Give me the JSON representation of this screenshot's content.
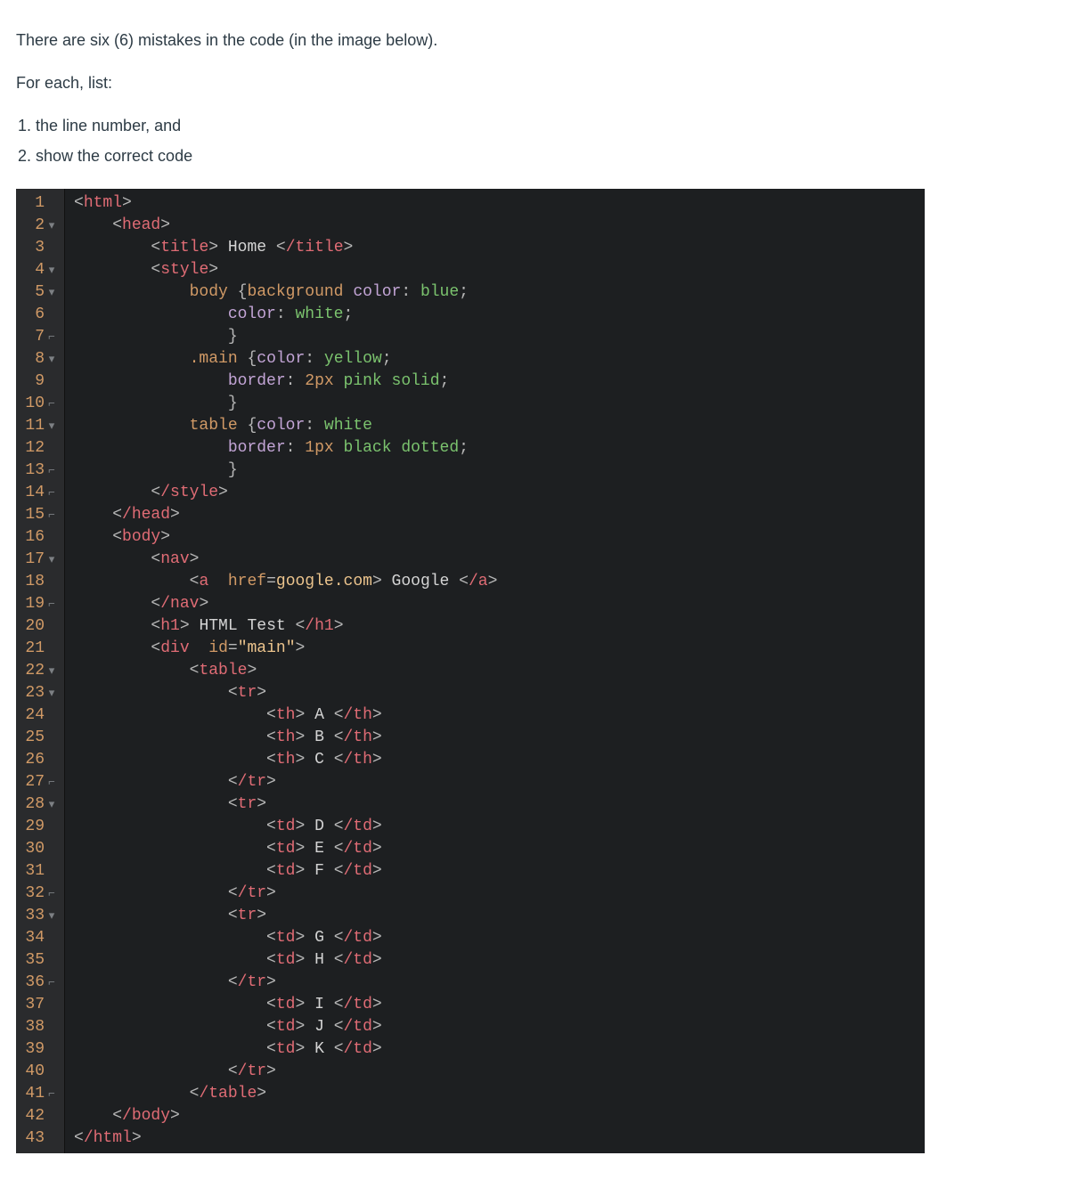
{
  "prompt": {
    "p1": "There are six (6) mistakes in the code (in the image below).",
    "p2": "For each, list:",
    "li1": "the line number, and",
    "li2": "show the correct code"
  },
  "gutter": [
    {
      "n": "1",
      "m": ""
    },
    {
      "n": "2",
      "m": "▾"
    },
    {
      "n": "3",
      "m": ""
    },
    {
      "n": "4",
      "m": "▾"
    },
    {
      "n": "5",
      "m": "▾"
    },
    {
      "n": "6",
      "m": ""
    },
    {
      "n": "7",
      "m": "⌐"
    },
    {
      "n": "8",
      "m": "▾"
    },
    {
      "n": "9",
      "m": ""
    },
    {
      "n": "10",
      "m": "⌐"
    },
    {
      "n": "11",
      "m": "▾"
    },
    {
      "n": "12",
      "m": ""
    },
    {
      "n": "13",
      "m": "⌐"
    },
    {
      "n": "14",
      "m": "⌐"
    },
    {
      "n": "15",
      "m": "⌐"
    },
    {
      "n": "16",
      "m": ""
    },
    {
      "n": "17",
      "m": "▾"
    },
    {
      "n": "18",
      "m": ""
    },
    {
      "n": "19",
      "m": "⌐"
    },
    {
      "n": "20",
      "m": ""
    },
    {
      "n": "21",
      "m": ""
    },
    {
      "n": "22",
      "m": "▾"
    },
    {
      "n": "23",
      "m": "▾"
    },
    {
      "n": "24",
      "m": ""
    },
    {
      "n": "25",
      "m": ""
    },
    {
      "n": "26",
      "m": ""
    },
    {
      "n": "27",
      "m": "⌐"
    },
    {
      "n": "28",
      "m": "▾"
    },
    {
      "n": "29",
      "m": ""
    },
    {
      "n": "30",
      "m": ""
    },
    {
      "n": "31",
      "m": ""
    },
    {
      "n": "32",
      "m": "⌐"
    },
    {
      "n": "33",
      "m": "▾"
    },
    {
      "n": "34",
      "m": ""
    },
    {
      "n": "35",
      "m": ""
    },
    {
      "n": "36",
      "m": "⌐"
    },
    {
      "n": "37",
      "m": ""
    },
    {
      "n": "38",
      "m": ""
    },
    {
      "n": "39",
      "m": ""
    },
    {
      "n": "40",
      "m": ""
    },
    {
      "n": "41",
      "m": "⌐"
    },
    {
      "n": "42",
      "m": ""
    },
    {
      "n": "43",
      "m": ""
    }
  ],
  "code_lines_raw": [
    "<html>",
    "    <head>",
    "        <title> Home </title>",
    "        <style>",
    "            body {background color: blue;",
    "                color: white;",
    "                }",
    "            .main {color: yellow;",
    "                border: 2px pink solid;",
    "                }",
    "            table {color: white",
    "                border: 1px black dotted;",
    "                }",
    "        </style>",
    "    </head>",
    "    <body>",
    "        <nav>",
    "            <a href=google.com> Google </a>",
    "        </nav>",
    "        <h1> HTML Test </h1>",
    "        <div id=\"main\">",
    "            <table>",
    "                <tr>",
    "                    <th> A </th>",
    "                    <th> B </th>",
    "                    <th> C </th>",
    "                </tr>",
    "                <tr>",
    "                    <td> D </td>",
    "                    <td> E </td>",
    "                    <td> F </td>",
    "                </tr>",
    "                <tr>",
    "                    <td> G </td>",
    "                    <td> H </td>",
    "                </tr>",
    "                    <td> I </td>",
    "                    <td> J </td>",
    "                    <td> K </td>",
    "                </tr>",
    "            </table>",
    "    </body>",
    "</html>"
  ]
}
